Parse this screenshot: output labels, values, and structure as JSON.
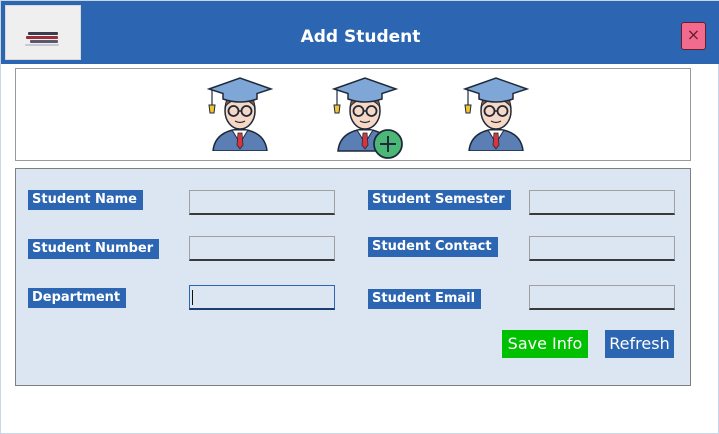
{
  "window": {
    "title": "Add  Student",
    "close_glyph": "×",
    "logo_icon": "books-stack-icon"
  },
  "banner": {
    "avatars": [
      {
        "icon": "graduate-student-icon",
        "badge": null
      },
      {
        "icon": "graduate-student-add-icon",
        "badge": "plus"
      },
      {
        "icon": "graduate-student-icon",
        "badge": null
      }
    ]
  },
  "form": {
    "labels": {
      "student_name": "Student Name",
      "student_number": "Student Number",
      "department": "Department",
      "student_semester": "Student Semester",
      "student_contact": "Student Contact",
      "student_email": "Student Email"
    },
    "values": {
      "student_name": "",
      "student_number": "",
      "department": "",
      "student_semester": "",
      "student_contact": "",
      "student_email": ""
    },
    "buttons": {
      "save": "Save Info",
      "refresh": "Refresh"
    }
  },
  "colors": {
    "accent": "#2c66b3",
    "panel": "#dce6f2",
    "save": "#00c000",
    "close": "#f26b8e"
  }
}
